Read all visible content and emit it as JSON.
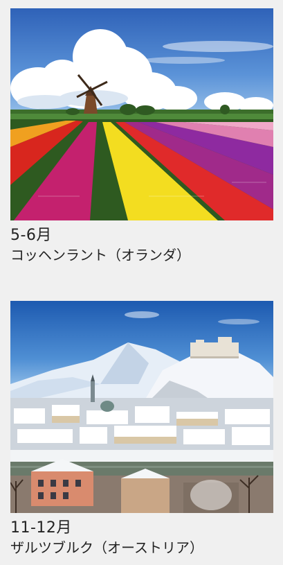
{
  "items": [
    {
      "months": "5-6月",
      "place": "コッヘンラント（オランダ）"
    },
    {
      "months": "11-12月",
      "place": "ザルツブルク（オーストリア）"
    }
  ]
}
